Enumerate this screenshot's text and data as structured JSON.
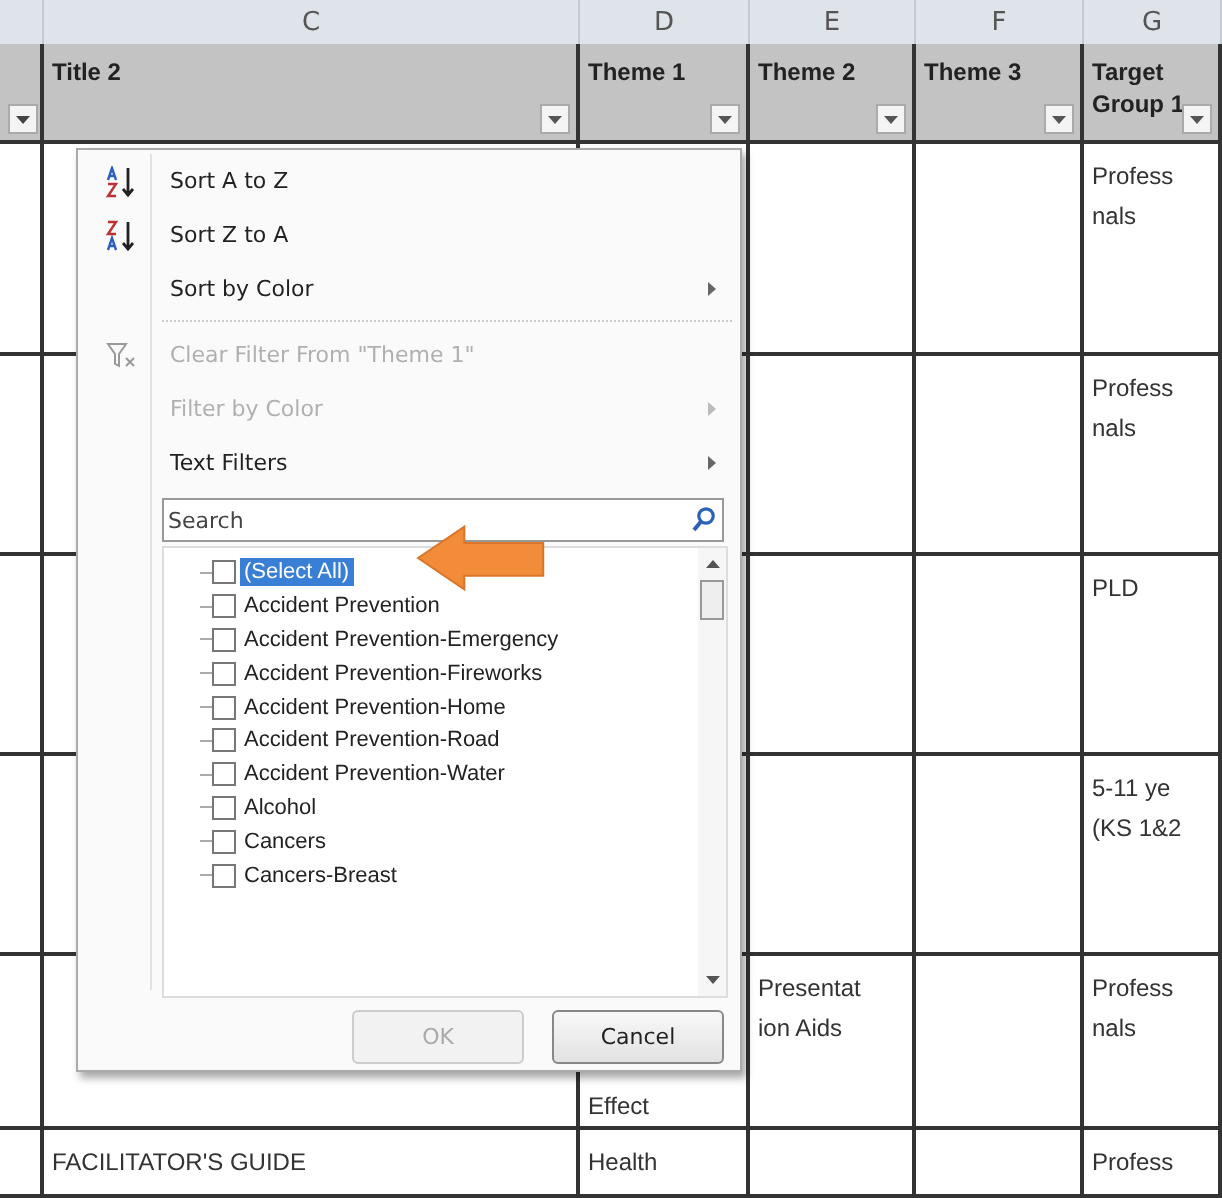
{
  "column_letters": [
    "C",
    "D",
    "E",
    "F",
    "G"
  ],
  "header": [
    {
      "label": "Title 2",
      "filter": true
    },
    {
      "label": "Theme 1",
      "filter": true
    },
    {
      "label": "Theme 2",
      "filter": true
    },
    {
      "label": "Theme 3",
      "filter": true
    },
    {
      "label": "Target Group 1",
      "filter": true
    }
  ],
  "rows": [
    {
      "cells": [
        "",
        "",
        "",
        "",
        [
          "Profess",
          "nals"
        ]
      ]
    },
    {
      "cells": [
        "",
        "",
        "",
        "",
        [
          "Profess",
          "nals"
        ]
      ]
    },
    {
      "cells": [
        "",
        "",
        "",
        "",
        [
          "PLD"
        ]
      ]
    },
    {
      "cells": [
        "",
        "",
        "",
        "",
        [
          "5-11 ye",
          "(KS 1&2"
        ]
      ]
    },
    {
      "cells": [
        "",
        [
          "Effect"
        ],
        [
          "Presentat",
          "ion Aids"
        ],
        "",
        [
          "Profess",
          "nals"
        ]
      ]
    },
    {
      "cells": [
        [
          "FACILITATOR'S GUIDE"
        ],
        [
          "Health"
        ],
        "",
        "",
        [
          "Profess"
        ]
      ]
    }
  ],
  "filter_menu": {
    "items": [
      {
        "kind": "sort-az",
        "label": "Sort A to Z",
        "disabled": false,
        "submenu": false
      },
      {
        "kind": "sort-za",
        "label": "Sort Z to A",
        "disabled": false,
        "submenu": false
      },
      {
        "kind": "plain",
        "label": "Sort by Color",
        "disabled": false,
        "submenu": true
      },
      {
        "kind": "separator"
      },
      {
        "kind": "clear-filter",
        "label": "Clear Filter From \"Theme 1\"",
        "disabled": true,
        "submenu": false
      },
      {
        "kind": "plain",
        "label": "Filter by Color",
        "disabled": true,
        "submenu": true
      },
      {
        "kind": "plain",
        "label": "Text Filters",
        "disabled": false,
        "submenu": true
      }
    ],
    "search": {
      "placeholder": "Search"
    },
    "values": [
      {
        "label": "(Select All)",
        "checked": false,
        "selected": true
      },
      {
        "label": "Accident Prevention",
        "checked": false,
        "selected": false
      },
      {
        "label": "Accident Prevention-Emergency",
        "checked": false,
        "selected": false
      },
      {
        "label": "Accident Prevention-Fireworks",
        "checked": false,
        "selected": false
      },
      {
        "label": "Accident Prevention-Home",
        "checked": false,
        "selected": false
      },
      {
        "label": "Accident Prevention-Road",
        "checked": false,
        "selected": false
      },
      {
        "label": "Accident Prevention-Water",
        "checked": false,
        "selected": false
      },
      {
        "label": "Alcohol",
        "checked": false,
        "selected": false
      },
      {
        "label": "Cancers",
        "checked": false,
        "selected": false
      },
      {
        "label": "Cancers-Breast",
        "checked": false,
        "selected": false
      }
    ],
    "buttons": [
      {
        "label": "OK",
        "disabled": true
      },
      {
        "label": "Cancel",
        "disabled": false
      }
    ]
  },
  "callout_arrow": true
}
